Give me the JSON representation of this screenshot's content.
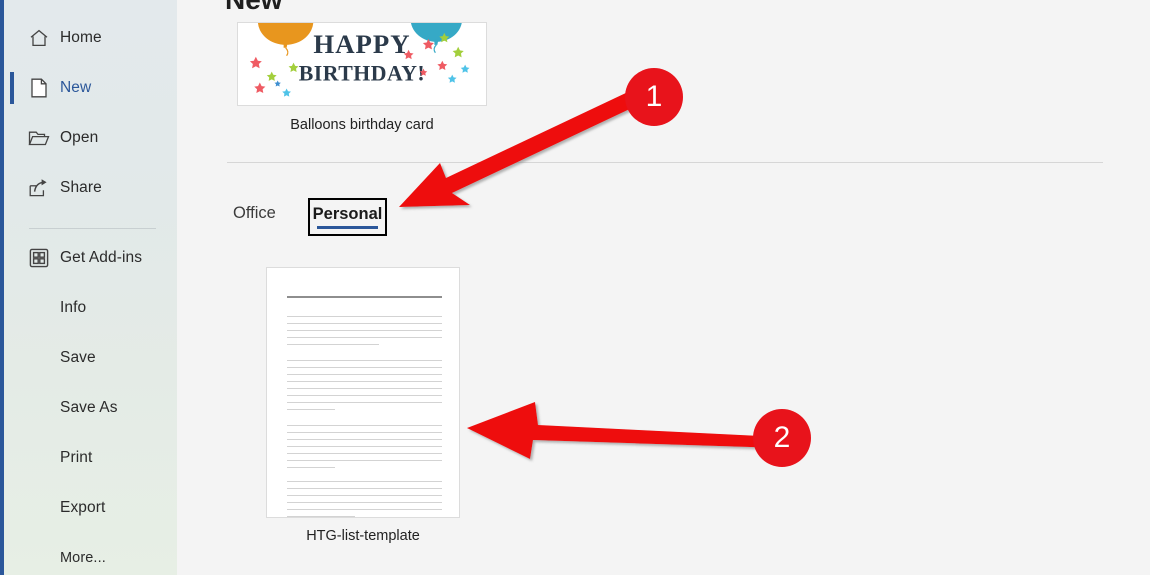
{
  "app": {
    "name": "Microsoft Word Backstage",
    "background_color": "#f4f4f4"
  },
  "sidebar": {
    "accent_color": "#2b579a",
    "background_gradient_top": "#e3e9ec",
    "background_gradient_bottom": "#e7efe5",
    "selected_item": "New",
    "items": [
      {
        "label": "Home",
        "icon": "home-icon",
        "selected": false,
        "has_icon": true
      },
      {
        "label": "New",
        "icon": "page-icon",
        "selected": true,
        "has_icon": true
      },
      {
        "label": "Open",
        "icon": "folder-icon",
        "selected": false,
        "has_icon": true
      },
      {
        "label": "Share",
        "icon": "share-icon",
        "selected": false,
        "has_icon": true
      },
      {
        "label": "Get Add-ins",
        "icon": "add-ins-icon",
        "selected": false,
        "has_icon": true
      },
      {
        "label": "Info",
        "icon": "",
        "selected": false,
        "has_icon": false
      },
      {
        "label": "Save",
        "icon": "",
        "selected": false,
        "has_icon": false
      },
      {
        "label": "Save As",
        "icon": "",
        "selected": false,
        "has_icon": false
      },
      {
        "label": "Print",
        "icon": "",
        "selected": false,
        "has_icon": false
      },
      {
        "label": "Export",
        "icon": "",
        "selected": false,
        "has_icon": false
      },
      {
        "label": "More...",
        "icon": "",
        "selected": false,
        "has_icon": false
      }
    ]
  },
  "main": {
    "title": "New",
    "featured_template": {
      "label": "Balloons birthday card",
      "art": {
        "headline_line1": "HAPPY",
        "headline_line2": "BIRTHDAY!",
        "headline_color": "#2b3a4a",
        "balloon_left_color": "#e8961e",
        "balloon_right_color": "#36a9c6",
        "background": "#ffffff"
      }
    },
    "tabs": [
      {
        "label": "Office",
        "selected": false,
        "focused": false
      },
      {
        "label": "Personal",
        "selected": true,
        "focused": true
      }
    ],
    "tab_underline_color": "#2b579a",
    "tab_focus_outline_color": "#000000",
    "personal_templates": [
      {
        "label": "HTG-list-template",
        "type": "document-preview"
      }
    ]
  },
  "annotations": {
    "color": "#e8131b",
    "markers": [
      {
        "number": "1",
        "points_to": "Personal tab"
      },
      {
        "number": "2",
        "points_to": "HTG-list-template thumbnail"
      }
    ]
  }
}
